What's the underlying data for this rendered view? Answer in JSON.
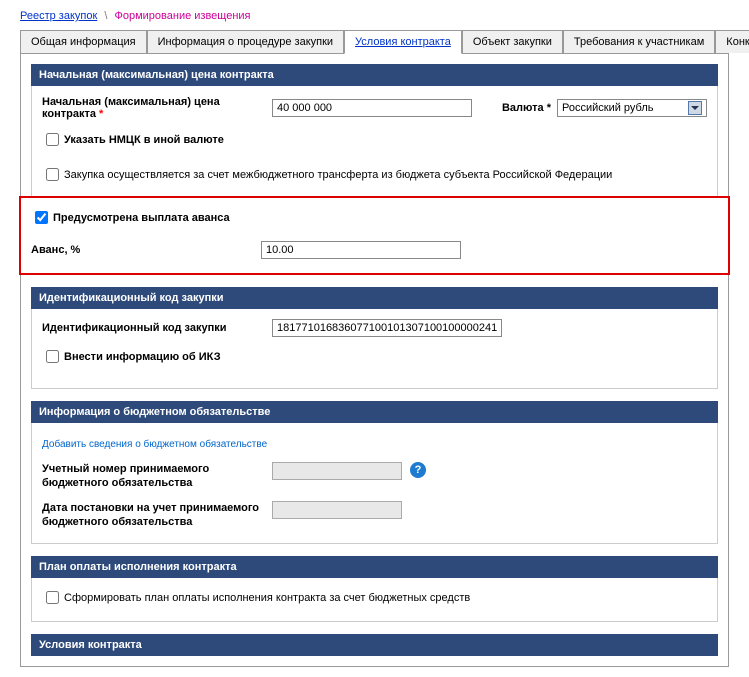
{
  "breadcrumb": {
    "root": "Реестр закупок",
    "sep": "\\",
    "current": "Формирование извещения"
  },
  "tabs": [
    {
      "label": "Общая информация"
    },
    {
      "label": "Информация о процедуре закупки"
    },
    {
      "label": "Условия контракта"
    },
    {
      "label": "Объект закупки"
    },
    {
      "label": "Требования к участникам"
    },
    {
      "label": "Конкурсная документация"
    }
  ],
  "section_price": {
    "header": "Начальная (максимальная) цена контракта",
    "price_label": "Начальная (максимальная) цена контракта",
    "price_value": "40 000 000",
    "currency_label": "Валюта",
    "currency_value": "Российский рубль",
    "nmck_label": "Указать НМЦК в иной валюте",
    "transfer_label": "Закупка осуществляется за счет межбюджетного трансферта из бюджета субъекта Российской Федерации"
  },
  "section_advance": {
    "advance_check_label": "Предусмотрена выплата аванса",
    "advance_label": "Аванс, %",
    "advance_value": "10.00"
  },
  "section_ikz": {
    "header": "Идентификационный код закупки",
    "ikz_label": "Идентификационный код закупки",
    "ikz_value": "181771016836077100101307100100000241",
    "ikz_check_label": "Внести информацию об ИКЗ"
  },
  "section_budget": {
    "header": "Информация о бюджетном обязательстве",
    "add_link": "Добавить сведения о бюджетном обязательстве",
    "reg_num_label": "Учетный номер принимаемого бюджетного обязательства",
    "date_label": "Дата постановки на учет принимаемого бюджетного обязательства"
  },
  "section_payment": {
    "header": "План оплаты исполнения контракта",
    "check_label": "Сформировать план оплаты исполнения контракта за счет бюджетных средств"
  },
  "section_conditions": {
    "header": "Условия контракта"
  },
  "req_marker": "*"
}
